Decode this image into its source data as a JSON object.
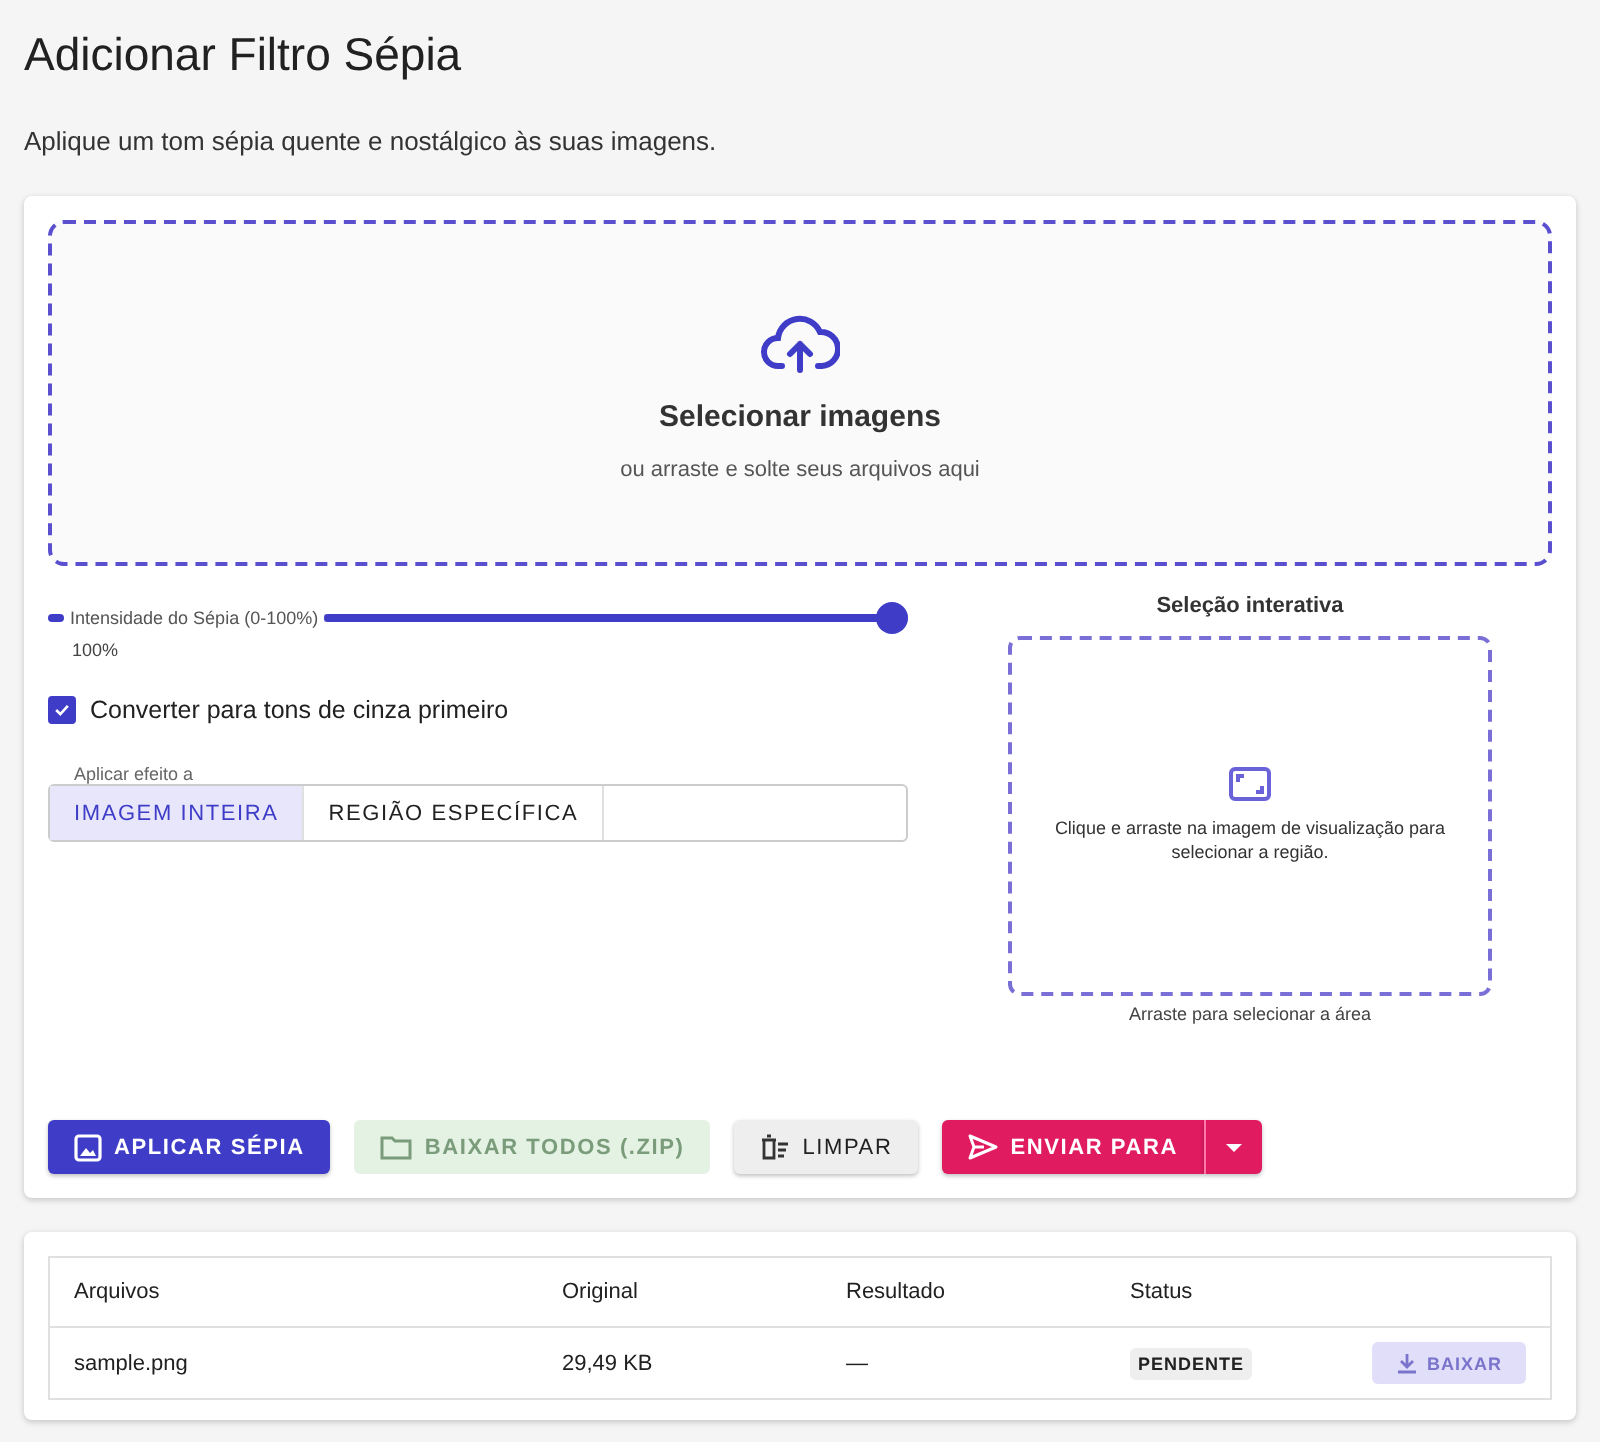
{
  "title": "Adicionar Filtro Sépia",
  "subtitle": "Aplique um tom sépia quente e nostálgico às suas imagens.",
  "dropzone": {
    "title": "Selecionar imagens",
    "hint": "ou arraste e solte seus arquivos aqui"
  },
  "slider": {
    "label": "Intensidade do Sépia (0-100%)",
    "level": 1.0,
    "reading": "100%"
  },
  "checkbox": {
    "label": "Converter para tons de cinza primeiro",
    "checked": true
  },
  "apply_to": {
    "legend": "Aplicar efeito a",
    "options": [
      {
        "label": "IMAGEM INTEIRA",
        "selected": true
      },
      {
        "label": "REGIÃO ESPECÍFICA",
        "selected": false
      }
    ]
  },
  "selection": {
    "title": "Seleção interativa",
    "text": "Clique e arraste na imagem de visualização para selecionar a região.",
    "caption": "Arraste para selecionar a área"
  },
  "buttons": [
    {
      "kind": "apply",
      "label": "APLICAR SÉPIA",
      "disabled": false
    },
    {
      "kind": "download",
      "label": "BAIXAR TODOS (.ZIP)",
      "disabled": true
    },
    {
      "kind": "clear",
      "label": "LIMPAR",
      "disabled": false
    },
    {
      "kind": "send",
      "label": "ENVIAR PARA",
      "disabled": false
    }
  ],
  "table": {
    "columns": [
      "Arquivos",
      "Original",
      "Resultado",
      "Status"
    ],
    "rows": [
      {
        "file": "sample.png",
        "original": "29,49 KB",
        "result": "—",
        "status": "PENDENTE",
        "action": {
          "label": "BAIXAR",
          "disabled": true
        }
      }
    ]
  }
}
